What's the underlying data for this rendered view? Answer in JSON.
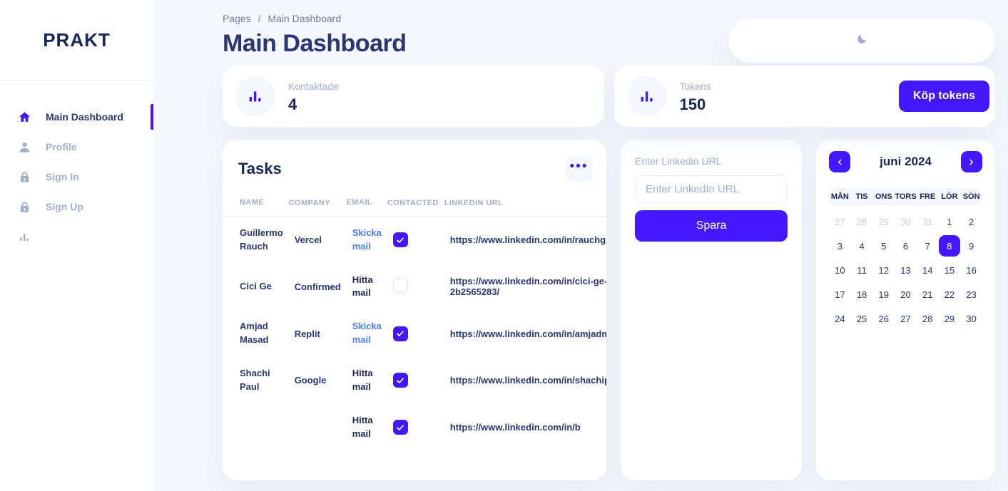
{
  "brand": {
    "name": "PRAKT"
  },
  "sidebar": {
    "items": [
      {
        "label": "Main Dashboard",
        "icon": "home-icon",
        "active": true
      },
      {
        "label": "Profile",
        "icon": "person-icon",
        "active": false
      },
      {
        "label": "Sign In",
        "icon": "lock-icon",
        "active": false
      },
      {
        "label": "Sign Up",
        "icon": "lock-icon",
        "active": false
      },
      {
        "label": "",
        "icon": "bar-chart-icon",
        "active": false
      }
    ]
  },
  "header": {
    "breadcrumb_parent": "Pages",
    "breadcrumb_separator": "/",
    "breadcrumb_current": "Main Dashboard",
    "title": "Main Dashboard",
    "theme_toggle_icon": "moon-icon"
  },
  "stats": [
    {
      "label": "Kontaktade",
      "value": "4",
      "icon": "bar-chart-icon"
    },
    {
      "label": "Tokens",
      "value": "150",
      "icon": "bar-chart-icon",
      "action_label": "Köp tokens"
    }
  ],
  "tasks": {
    "title": "Tasks",
    "menu_icon": "ellipsis-icon",
    "columns": [
      "NAME",
      "COMPANY",
      "EMAIL",
      "CONTACTED",
      "LINKEDIN URL"
    ],
    "rows": [
      {
        "name": "Guillermo Rauch",
        "company": "Vercel",
        "email_action": "Skicka mail",
        "email_action_type": "send",
        "contacted": true,
        "url": "https://www.linkedin.com/in/rauchg/"
      },
      {
        "name": "Cici Ge",
        "company": "Confirmed",
        "email_action": "Hitta mail",
        "email_action_type": "find",
        "contacted": false,
        "url": "https://www.linkedin.com/in/cici-ge-2b2565283/"
      },
      {
        "name": "Amjad Masad",
        "company": "Replit",
        "email_action": "Skicka mail",
        "email_action_type": "send",
        "contacted": true,
        "url": "https://www.linkedin.com/in/amjadmasad/"
      },
      {
        "name": "Shachi Paul",
        "company": "Google",
        "email_action": "Hitta mail",
        "email_action_type": "find",
        "contacted": true,
        "url": "https://www.linkedin.com/in/shachipaul/"
      },
      {
        "name": "",
        "company": "",
        "email_action": "Hitta mail",
        "email_action_type": "find",
        "contacted": true,
        "url": "https://www.linkedin.com/in/b"
      }
    ]
  },
  "linkedin_panel": {
    "label": "Enter Linkedin URL",
    "placeholder": "Enter LinkedIn URL",
    "value": "",
    "save_label": "Spara"
  },
  "calendar": {
    "month_label": "juni 2024",
    "prev_icon": "chevron-left-icon",
    "next_icon": "chevron-right-icon",
    "weekdays": [
      "MÅN",
      "TIS",
      "ONS",
      "TORS",
      "FRE",
      "LÖR",
      "SÖN"
    ],
    "days": [
      {
        "n": "27",
        "muted": true
      },
      {
        "n": "28",
        "muted": true
      },
      {
        "n": "29",
        "muted": true
      },
      {
        "n": "30",
        "muted": true
      },
      {
        "n": "31",
        "muted": true
      },
      {
        "n": "1"
      },
      {
        "n": "2"
      },
      {
        "n": "3"
      },
      {
        "n": "4"
      },
      {
        "n": "5"
      },
      {
        "n": "6"
      },
      {
        "n": "7"
      },
      {
        "n": "8",
        "selected": true
      },
      {
        "n": "9"
      },
      {
        "n": "10"
      },
      {
        "n": "11"
      },
      {
        "n": "12"
      },
      {
        "n": "13"
      },
      {
        "n": "14"
      },
      {
        "n": "15"
      },
      {
        "n": "16"
      },
      {
        "n": "17"
      },
      {
        "n": "18"
      },
      {
        "n": "19"
      },
      {
        "n": "20"
      },
      {
        "n": "21"
      },
      {
        "n": "22"
      },
      {
        "n": "23"
      },
      {
        "n": "24"
      },
      {
        "n": "25"
      },
      {
        "n": "26"
      },
      {
        "n": "27"
      },
      {
        "n": "28"
      },
      {
        "n": "29"
      },
      {
        "n": "30"
      }
    ]
  },
  "colors": {
    "accent": "#4318FF",
    "page_bg": "#F4F7FE",
    "heading": "#2B3674",
    "muted": "#A3AED0",
    "link_blue": "#4880FF"
  }
}
